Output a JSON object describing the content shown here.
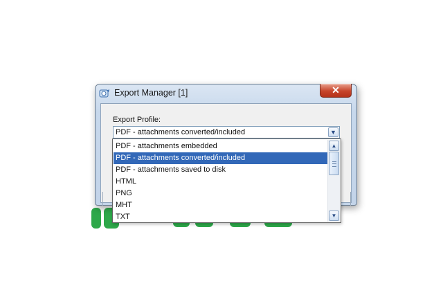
{
  "window": {
    "title": "Export Manager [1]",
    "close_glyph": "✕",
    "icon": "export-manager-icon"
  },
  "export_profile": {
    "label": "Export Profile:",
    "selected_value": "PDF - attachments converted/included",
    "options": [
      "PDF - attachments embedded",
      "PDF - attachments converted/included",
      "PDF - attachments saved to disk",
      "HTML",
      "PNG",
      "MHT",
      "TXT"
    ],
    "highlighted_index": 1
  },
  "scrollbar": {
    "up_glyph": "▲",
    "down_glyph": "▼",
    "dropdown_glyph": "▼"
  },
  "colors": {
    "selection": "#3268b8",
    "close_button": "#c7452b",
    "background_text": "#2ea84a"
  }
}
